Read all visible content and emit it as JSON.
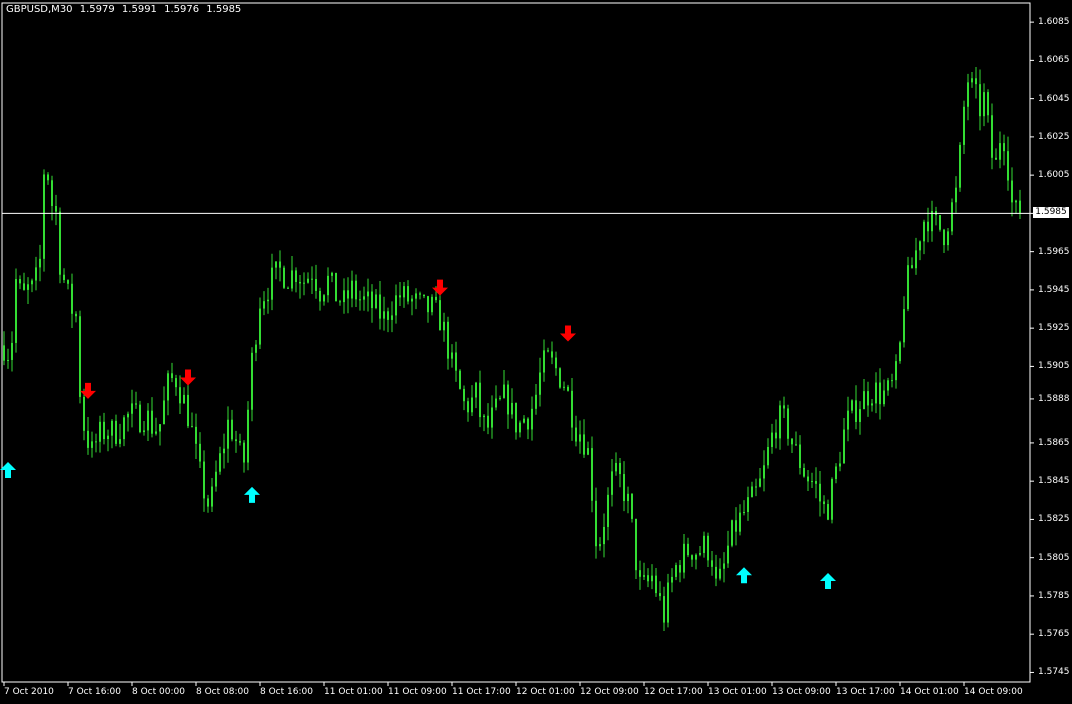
{
  "header": {
    "symbol": "GBPUSD,M30",
    "open": "1.5979",
    "high": "1.5991",
    "low": "1.5976",
    "close": "1.5985"
  },
  "current_price_label": "1.5985",
  "colors": {
    "background": "#000000",
    "candle": "#33dd33",
    "axis": "#ffffff",
    "sell_arrow": "#ff0000",
    "buy_arrow": "#00ffff"
  },
  "chart_data": {
    "type": "candlestick",
    "symbol": "GBPUSD",
    "timeframe": "M30",
    "ylim": [
      1.574,
      1.6095
    ],
    "y_ticks": [
      "1.6085",
      "1.6065",
      "1.6045",
      "1.6025",
      "1.6005",
      "1.5985",
      "1.5965",
      "1.5945",
      "1.5925",
      "1.5905",
      "1.5888",
      "1.5865",
      "1.5845",
      "1.5825",
      "1.5805",
      "1.5785",
      "1.5765",
      "1.5745"
    ],
    "x_ticks": [
      "7 Oct 2010",
      "7 Oct 16:00",
      "8 Oct 00:00",
      "8 Oct 08:00",
      "8 Oct 16:00",
      "11 Oct 01:00",
      "11 Oct 09:00",
      "11 Oct 17:00",
      "12 Oct 01:00",
      "12 Oct 09:00",
      "12 Oct 17:00",
      "13 Oct 01:00",
      "13 Oct 09:00",
      "13 Oct 17:00",
      "14 Oct 01:00",
      "14 Oct 09:00"
    ],
    "current_price": 1.5985,
    "path": [
      [
        0,
        1.588
      ],
      [
        5,
        1.5925
      ],
      [
        10,
        1.5905
      ],
      [
        16,
        1.595
      ],
      [
        22,
        1.594
      ],
      [
        28,
        1.5945
      ],
      [
        34,
        1.5945
      ],
      [
        40,
        1.596
      ],
      [
        43,
        1.6008
      ],
      [
        48,
        1.6005
      ],
      [
        52,
        1.599
      ],
      [
        56,
        1.5985
      ],
      [
        60,
        1.596
      ],
      [
        66,
        1.5945
      ],
      [
        72,
        1.5935
      ],
      [
        77,
        1.593
      ],
      [
        81,
        1.588
      ],
      [
        86,
        1.587
      ],
      [
        92,
        1.586
      ],
      [
        98,
        1.5868
      ],
      [
        106,
        1.5872
      ],
      [
        114,
        1.587
      ],
      [
        122,
        1.5875
      ],
      [
        130,
        1.588
      ],
      [
        138,
        1.5878
      ],
      [
        146,
        1.588
      ],
      [
        154,
        1.5872
      ],
      [
        160,
        1.5875
      ],
      [
        168,
        1.5895
      ],
      [
        175,
        1.59
      ],
      [
        182,
        1.589
      ],
      [
        188,
        1.588
      ],
      [
        193,
        1.5868
      ],
      [
        198,
        1.5852
      ],
      [
        204,
        1.584
      ],
      [
        210,
        1.583
      ],
      [
        216,
        1.5848
      ],
      [
        222,
        1.586
      ],
      [
        228,
        1.5875
      ],
      [
        234,
        1.587
      ],
      [
        240,
        1.5858
      ],
      [
        245,
        1.5855
      ],
      [
        250,
        1.59
      ],
      [
        255,
        1.592
      ],
      [
        260,
        1.594
      ],
      [
        266,
        1.5945
      ],
      [
        272,
        1.595
      ],
      [
        280,
        1.5955
      ],
      [
        288,
        1.5952
      ],
      [
        296,
        1.5955
      ],
      [
        304,
        1.595
      ],
      [
        312,
        1.5955
      ],
      [
        320,
        1.5945
      ],
      [
        328,
        1.595
      ],
      [
        336,
        1.5942
      ],
      [
        344,
        1.5938
      ],
      [
        352,
        1.5945
      ],
      [
        360,
        1.594
      ],
      [
        368,
        1.5938
      ],
      [
        376,
        1.5935
      ],
      [
        384,
        1.593
      ],
      [
        392,
        1.5938
      ],
      [
        400,
        1.5942
      ],
      [
        408,
        1.594
      ],
      [
        416,
        1.5938
      ],
      [
        424,
        1.5935
      ],
      [
        432,
        1.5935
      ],
      [
        440,
        1.593
      ],
      [
        446,
        1.592
      ],
      [
        452,
        1.5905
      ],
      [
        458,
        1.5895
      ],
      [
        464,
        1.5885
      ],
      [
        470,
        1.5885
      ],
      [
        476,
        1.589
      ],
      [
        482,
        1.5875
      ],
      [
        488,
        1.5873
      ],
      [
        494,
        1.588
      ],
      [
        500,
        1.5885
      ],
      [
        506,
        1.589
      ],
      [
        512,
        1.588
      ],
      [
        518,
        1.5873
      ],
      [
        524,
        1.5878
      ],
      [
        530,
        1.588
      ],
      [
        536,
        1.589
      ],
      [
        542,
        1.5905
      ],
      [
        548,
        1.5908
      ],
      [
        554,
        1.5905
      ],
      [
        560,
        1.59
      ],
      [
        566,
        1.5895
      ],
      [
        570,
        1.5885
      ],
      [
        576,
        1.5873
      ],
      [
        582,
        1.587
      ],
      [
        588,
        1.586
      ],
      [
        592,
        1.584
      ],
      [
        596,
        1.5815
      ],
      [
        600,
        1.5815
      ],
      [
        606,
        1.583
      ],
      [
        612,
        1.5845
      ],
      [
        618,
        1.5848
      ],
      [
        624,
        1.584
      ],
      [
        630,
        1.583
      ],
      [
        634,
        1.581
      ],
      [
        640,
        1.579
      ],
      [
        646,
        1.579
      ],
      [
        652,
        1.5795
      ],
      [
        658,
        1.5785
      ],
      [
        664,
        1.5775
      ],
      [
        670,
        1.579
      ],
      [
        676,
        1.58
      ],
      [
        682,
        1.5805
      ],
      [
        690,
        1.581
      ],
      [
        698,
        1.5808
      ],
      [
        706,
        1.5812
      ],
      [
        712,
        1.5805
      ],
      [
        716,
        1.579
      ],
      [
        722,
        1.5795
      ],
      [
        728,
        1.581
      ],
      [
        734,
        1.582
      ],
      [
        740,
        1.5825
      ],
      [
        746,
        1.583
      ],
      [
        752,
        1.5835
      ],
      [
        758,
        1.584
      ],
      [
        764,
        1.585
      ],
      [
        770,
        1.5865
      ],
      [
        776,
        1.5875
      ],
      [
        782,
        1.5878
      ],
      [
        788,
        1.5872
      ],
      [
        794,
        1.5862
      ],
      [
        800,
        1.5855
      ],
      [
        806,
        1.5848
      ],
      [
        812,
        1.5845
      ],
      [
        818,
        1.584
      ],
      [
        822,
        1.583
      ],
      [
        828,
        1.5832
      ],
      [
        834,
        1.5845
      ],
      [
        840,
        1.586
      ],
      [
        846,
        1.5875
      ],
      [
        852,
        1.588
      ],
      [
        858,
        1.5885
      ],
      [
        866,
        1.589
      ],
      [
        874,
        1.5893
      ],
      [
        882,
        1.589
      ],
      [
        890,
        1.5892
      ],
      [
        896,
        1.59
      ],
      [
        900,
        1.5915
      ],
      [
        904,
        1.594
      ],
      [
        908,
        1.595
      ],
      [
        914,
        1.596
      ],
      [
        920,
        1.5975
      ],
      [
        926,
        1.5985
      ],
      [
        932,
        1.598
      ],
      [
        938,
        1.5978
      ],
      [
        944,
        1.5975
      ],
      [
        950,
        1.5985
      ],
      [
        956,
        1.5995
      ],
      [
        960,
        1.6015
      ],
      [
        964,
        1.604
      ],
      [
        968,
        1.6055
      ],
      [
        972,
        1.605
      ],
      [
        976,
        1.6045
      ],
      [
        980,
        1.604
      ],
      [
        984,
        1.6045
      ],
      [
        988,
        1.603
      ],
      [
        992,
        1.6015
      ],
      [
        996,
        1.601
      ],
      [
        1000,
        1.6025
      ],
      [
        1004,
        1.6025
      ],
      [
        1008,
        1.601
      ],
      [
        1012,
        1.599
      ],
      [
        1016,
        1.5985
      ],
      [
        1020,
        1.5985
      ]
    ],
    "bars": 255,
    "signals": [
      {
        "dir": "up",
        "price": 1.5855,
        "bar": 1
      },
      {
        "dir": "down",
        "price": 1.5888,
        "bar": 21
      },
      {
        "dir": "down",
        "price": 1.5895,
        "bar": 46
      },
      {
        "dir": "up",
        "price": 1.5842,
        "bar": 62
      },
      {
        "dir": "down",
        "price": 1.5942,
        "bar": 109
      },
      {
        "dir": "down",
        "price": 1.5918,
        "bar": 141
      },
      {
        "dir": "up",
        "price": 1.58,
        "bar": 185
      },
      {
        "dir": "up",
        "price": 1.5797,
        "bar": 206
      }
    ]
  }
}
